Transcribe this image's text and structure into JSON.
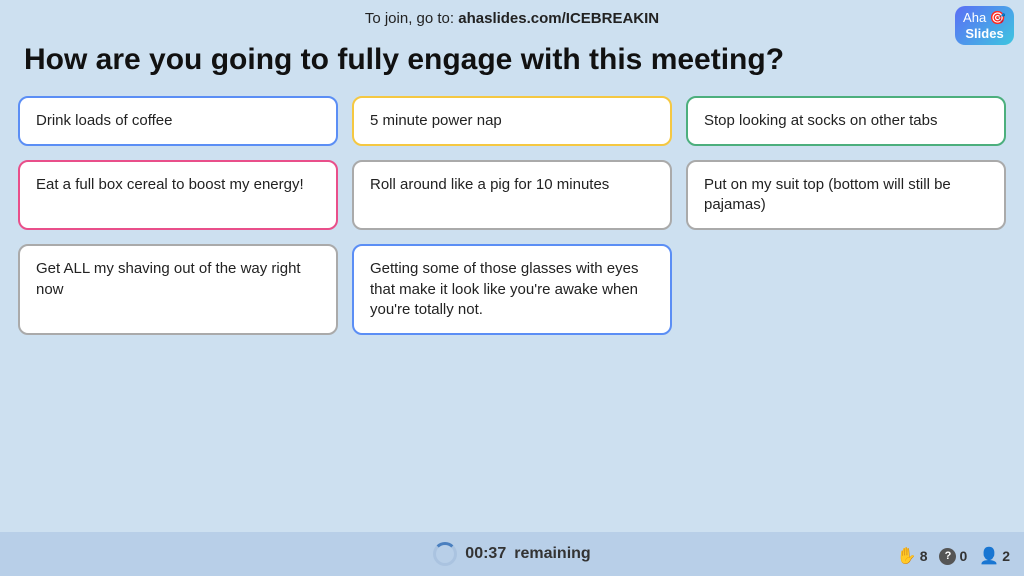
{
  "topbar": {
    "join_text": "To join, go to: ",
    "join_url": "ahaslides.com/ICEBREAKIN"
  },
  "logo": {
    "line1": "Aha",
    "line2": "Slides",
    "icon": "🎯"
  },
  "question": {
    "text": "How are you going to fully engage with this meeting?"
  },
  "cards": [
    {
      "id": 1,
      "text": "Drink loads of coffee",
      "border": "border-blue",
      "col": 1,
      "row": 1
    },
    {
      "id": 2,
      "text": "5 minute power nap",
      "border": "border-yellow",
      "col": 2,
      "row": 1
    },
    {
      "id": 3,
      "text": "Stop looking at socks on other tabs",
      "border": "border-green",
      "col": 3,
      "row": 1
    },
    {
      "id": 4,
      "text": "Eat a full box cereal to boost my energy!",
      "border": "border-pink",
      "col": 1,
      "row": 2
    },
    {
      "id": 5,
      "text": "Roll around like a pig for 10 minutes",
      "border": "border-gray",
      "col": 2,
      "row": 2
    },
    {
      "id": 6,
      "text": "Put on my suit top (bottom will still be pajamas)",
      "border": "border-gray2",
      "col": 3,
      "row": 2
    },
    {
      "id": 7,
      "text": "Get ALL my shaving out of the way right now",
      "border": "border-gray",
      "col": 1,
      "row": 3
    },
    {
      "id": 8,
      "text": "Getting some of those glasses with eyes that make it look like you're awake when you're totally not.",
      "border": "border-blue3",
      "col": 2,
      "row": 3
    }
  ],
  "timer": {
    "time": "00:37",
    "label": "remaining"
  },
  "status": {
    "hands": "8",
    "questions": "0",
    "people": "2"
  }
}
